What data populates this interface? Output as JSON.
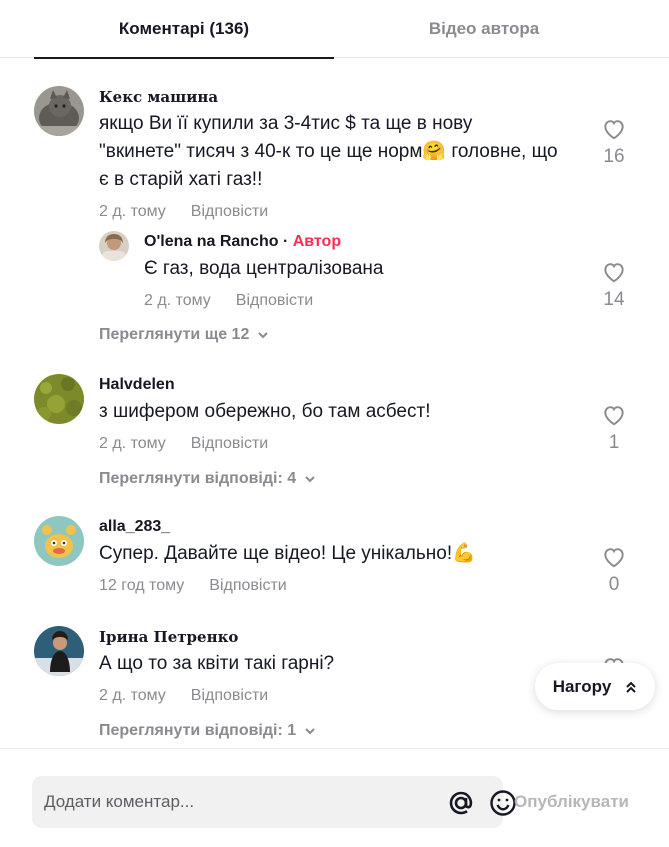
{
  "tabs": {
    "comments": "Коментарі (136)",
    "author_videos": "Відео автора"
  },
  "comments": [
    {
      "username": "Кекс машина",
      "text": "якщо Ви її купили за 3-4тис $ та ще в нову \"вкинете\" тисяч з 40-к то це ще норм🤗 головне, що є в старій хаті газ!!",
      "time": "2 д. тому",
      "reply_label": "Відповісти",
      "likes": "16",
      "replies": [
        {
          "username": "O'lena na Rancho",
          "separator": "·",
          "author_tag": "Автор",
          "text": "Є газ, вода централізована",
          "time": "2 д. тому",
          "reply_label": "Відповісти",
          "likes": "14"
        }
      ],
      "more_label": "Переглянути ще 12"
    },
    {
      "username": "Halvdelen",
      "text": "з шифером обережно, бо там асбест!",
      "time": "2 д. тому",
      "reply_label": "Відповісти",
      "likes": "1",
      "more_label": "Переглянути відповіді: 4"
    },
    {
      "username": "alla_283_",
      "text": "Супер. Давайте ще відео! Це унікально!💪",
      "time": "12 год тому",
      "reply_label": "Відповісти",
      "likes": "0"
    },
    {
      "username": "Ірина Петренко",
      "text": "А що то за квіти такі гарні?",
      "time": "2 д. тому",
      "reply_label": "Відповісти",
      "more_label": "Переглянути відповіді: 1"
    }
  ],
  "back_to_top": "Нагору",
  "composer": {
    "placeholder": "Додати коментар...",
    "publish_label": "Опублікувати"
  },
  "icons": {
    "like": "heart-icon",
    "more": "chevron-down-icon",
    "back_to_top": "double-chevron-up-icon",
    "mention": "at-icon",
    "emoji": "smiley-icon"
  },
  "colors": {
    "author_tag": "#fe2c55",
    "secondary_text": "#8a8b91",
    "publish_disabled": "#b6b7bb"
  }
}
